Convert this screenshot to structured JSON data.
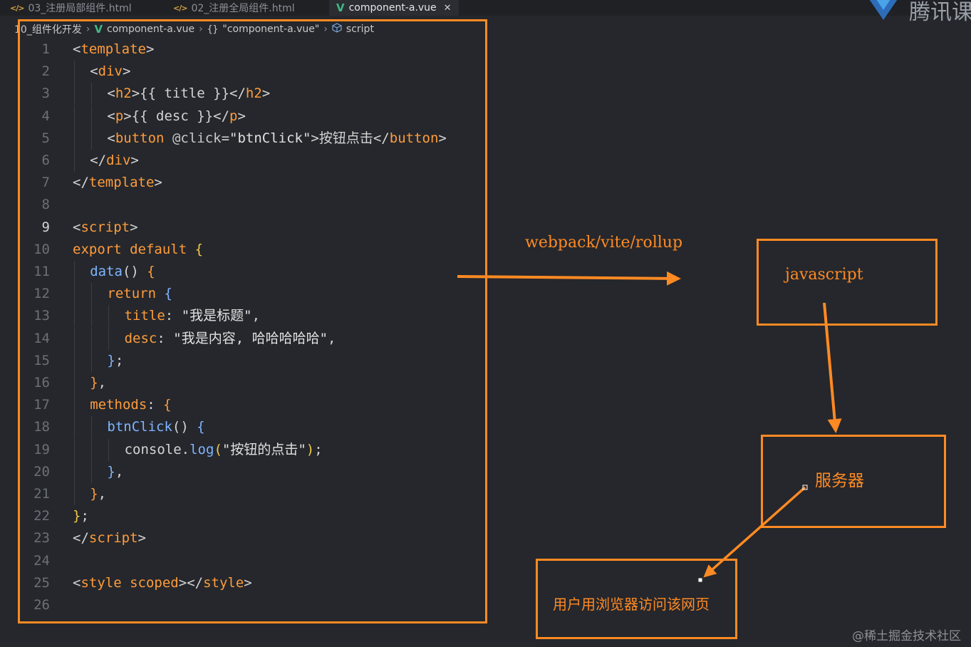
{
  "tabs": [
    {
      "icon": "</>",
      "label": "03_注册局部组件.html"
    },
    {
      "icon": "</>",
      "label": "02_注册全局组件.html"
    },
    {
      "icon": "V",
      "label": "component-a.vue",
      "close": "✕"
    }
  ],
  "logo_text": "腾讯课",
  "breadcrumb": {
    "folder": "10_组件化开发",
    "file": "component-a.vue",
    "block": "\"component-a.vue\"",
    "section": "script"
  },
  "code_lines": [
    {
      "n": "1",
      "indent": 0,
      "tokens": [
        [
          "br",
          "<"
        ],
        [
          "tag",
          "template"
        ],
        [
          "br",
          ">"
        ]
      ]
    },
    {
      "n": "2",
      "indent": 1,
      "tokens": [
        [
          "br",
          "<"
        ],
        [
          "tag",
          "div"
        ],
        [
          "br",
          ">"
        ]
      ]
    },
    {
      "n": "3",
      "indent": 2,
      "tokens": [
        [
          "br",
          "<"
        ],
        [
          "tag",
          "h2"
        ],
        [
          "br",
          ">{{ title }}</"
        ],
        [
          "tag",
          "h2"
        ],
        [
          "br",
          ">"
        ]
      ]
    },
    {
      "n": "4",
      "indent": 2,
      "tokens": [
        [
          "br",
          "<"
        ],
        [
          "tag",
          "p"
        ],
        [
          "br",
          ">{{ desc }}</"
        ],
        [
          "tag",
          "p"
        ],
        [
          "br",
          ">"
        ]
      ]
    },
    {
      "n": "5",
      "indent": 2,
      "tokens": [
        [
          "br",
          "<"
        ],
        [
          "tag",
          "button"
        ],
        [
          "br",
          " "
        ],
        [
          "attr",
          "@click"
        ],
        [
          "br",
          "="
        ],
        [
          "str",
          "\"btnClick\""
        ],
        [
          "br",
          ">按钮点击</"
        ],
        [
          "tag",
          "button"
        ],
        [
          "br",
          ">"
        ]
      ]
    },
    {
      "n": "6",
      "indent": 1,
      "tokens": [
        [
          "br",
          "</"
        ],
        [
          "tag",
          "div"
        ],
        [
          "br",
          ">"
        ]
      ]
    },
    {
      "n": "7",
      "indent": 0,
      "tokens": [
        [
          "br",
          "</"
        ],
        [
          "tag",
          "template"
        ],
        [
          "br",
          ">"
        ]
      ]
    },
    {
      "n": "8",
      "indent": 0,
      "tokens": []
    },
    {
      "n": "9",
      "indent": 0,
      "current": true,
      "tokens": [
        [
          "br",
          "<"
        ],
        [
          "tag",
          "script"
        ],
        [
          "br",
          ">"
        ]
      ]
    },
    {
      "n": "10",
      "indent": 0,
      "tokens": [
        [
          "kw",
          "export"
        ],
        [
          "p",
          " "
        ],
        [
          "kw",
          "default"
        ],
        [
          "p",
          " "
        ],
        [
          "y",
          "{"
        ]
      ]
    },
    {
      "n": "11",
      "indent": 1,
      "tokens": [
        [
          "fn",
          "data"
        ],
        [
          "p",
          "() "
        ],
        [
          "kw",
          "{"
        ]
      ]
    },
    {
      "n": "12",
      "indent": 2,
      "tokens": [
        [
          "kw",
          "return"
        ],
        [
          "p",
          " "
        ],
        [
          "fn",
          "{"
        ]
      ]
    },
    {
      "n": "13",
      "indent": 3,
      "tokens": [
        [
          "key",
          "title"
        ],
        [
          "p",
          ": "
        ],
        [
          "str",
          "\"我是标题\""
        ],
        [
          "p",
          ","
        ]
      ]
    },
    {
      "n": "14",
      "indent": 3,
      "tokens": [
        [
          "key",
          "desc"
        ],
        [
          "p",
          ": "
        ],
        [
          "str",
          "\"我是内容, 哈哈哈哈哈\""
        ],
        [
          "p",
          ","
        ]
      ]
    },
    {
      "n": "15",
      "indent": 2,
      "tokens": [
        [
          "fn",
          "}"
        ],
        [
          "p",
          ";"
        ]
      ]
    },
    {
      "n": "16",
      "indent": 1,
      "tokens": [
        [
          "kw",
          "}"
        ],
        [
          "p",
          ","
        ]
      ]
    },
    {
      "n": "17",
      "indent": 1,
      "tokens": [
        [
          "key",
          "methods"
        ],
        [
          "p",
          ": "
        ],
        [
          "kw",
          "{"
        ]
      ]
    },
    {
      "n": "18",
      "indent": 2,
      "tokens": [
        [
          "fn",
          "btnClick"
        ],
        [
          "p",
          "() "
        ],
        [
          "fn",
          "{"
        ]
      ]
    },
    {
      "n": "19",
      "indent": 3,
      "tokens": [
        [
          "p",
          "console."
        ],
        [
          "fn",
          "log"
        ],
        [
          "y",
          "("
        ],
        [
          "str",
          "\"按钮的点击\""
        ],
        [
          "y",
          ")"
        ],
        [
          "p",
          ";"
        ]
      ]
    },
    {
      "n": "20",
      "indent": 2,
      "tokens": [
        [
          "fn",
          "}"
        ],
        [
          "p",
          ","
        ]
      ]
    },
    {
      "n": "21",
      "indent": 1,
      "tokens": [
        [
          "kw",
          "}"
        ],
        [
          "p",
          ","
        ]
      ]
    },
    {
      "n": "22",
      "indent": 0,
      "tokens": [
        [
          "y",
          "}"
        ],
        [
          "p",
          ";"
        ]
      ]
    },
    {
      "n": "23",
      "indent": 0,
      "tokens": [
        [
          "br",
          "</"
        ],
        [
          "tag",
          "script"
        ],
        [
          "br",
          ">"
        ]
      ]
    },
    {
      "n": "24",
      "indent": 0,
      "tokens": []
    },
    {
      "n": "25",
      "indent": 0,
      "tokens": [
        [
          "br",
          "<"
        ],
        [
          "tag",
          "style"
        ],
        [
          "br",
          " "
        ],
        [
          "kw",
          "scoped"
        ],
        [
          "br",
          "></"
        ],
        [
          "tag",
          "style"
        ],
        [
          "br",
          ">"
        ]
      ]
    },
    {
      "n": "26",
      "indent": 0,
      "tokens": []
    }
  ],
  "diagram": {
    "bundler_label": "webpack/vite/rollup",
    "js_label": "javascript",
    "server_label": "服务器",
    "browser_label": "用户用浏览器访问该网页"
  },
  "watermark": "@稀土掘金技术社区",
  "colors": {
    "accent": "#ff8a23",
    "tag": "#ff9c3b",
    "function": "#7fb4ff",
    "vue": "#41b883"
  }
}
